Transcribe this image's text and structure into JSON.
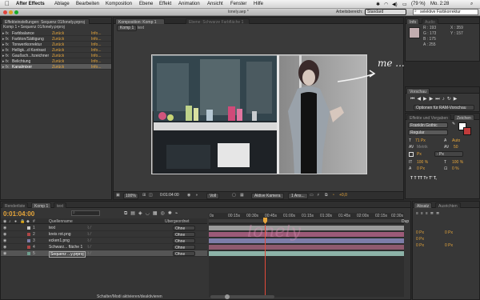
{
  "menubar": {
    "app": "After Effects",
    "items": [
      "Ablage",
      "Bearbeiten",
      "Komposition",
      "Ebene",
      "Effekt",
      "Animation",
      "Ansicht",
      "Fenster",
      "Hilfe"
    ],
    "battery": "(79 %)",
    "clock": "Mo. 2:28"
  },
  "titlebar": {
    "file": "lonely.aep *",
    "workspace_label": "Arbeitsbereich:",
    "workspace_value": "Standard",
    "search_value": "selektive Farbkorrektur"
  },
  "effects_panel": {
    "tab": "Effekteinstellungen: Sequenz 01/lonely.prproj",
    "breadcrumb": "Komp 1 • Sequenz 01/lonely.prproj",
    "reset": "Zurück",
    "info": "Info...",
    "effects": [
      "Farbbalance",
      "Farbton/Sättigung",
      "Tonwertkorrektur",
      "Helligk...d Kontrast",
      "Gaußsch...hzeichner",
      "Belichtung",
      "Kanalmixer"
    ]
  },
  "comp_panel": {
    "tab": "Komposition: Komp 1",
    "tab2": "Ebene: Schwarze Farbfläche 1",
    "subtab": "Komp 1",
    "subtab2": "text",
    "handwriting": "me ..."
  },
  "viewer_bar": {
    "zoom": "100%",
    "timecode": "0:01:04:00",
    "resolution": "Voll",
    "camera": "Aktive Kamera",
    "views": "1 Ans...",
    "offset": "+0,0"
  },
  "info_panel": {
    "tab": "Info",
    "tab2": "Audio",
    "r": "R : 193",
    "g": "G : 173",
    "b": "B : 175",
    "a": "A : 255",
    "x": "X : 359",
    "y": "Y : 157"
  },
  "preview_panel": {
    "tab": "Vorschau",
    "options": "Optionen für RAM-Vorschau"
  },
  "char_panel": {
    "tab": "Effekte und Vorgaben",
    "tab2": "Zeichen",
    "font": "Franklin Gothic",
    "style": "Regular",
    "size": "71 Px",
    "auto": "Auto",
    "metrics": "Metrik",
    "tracking": "50",
    "px": "Px",
    "px_dash": "- Px",
    "pct": "100 %",
    "pct2": "100 %",
    "baseline": "0 Px",
    "pct3": "0 %",
    "tT": "T  T  TT  Tт  T'  T,"
  },
  "para_panel": {
    "tab": "Absatz",
    "tab2": "Ausrichten",
    "v1": "0 Px",
    "v2": "0 Px",
    "v3": "0 Px",
    "v4": "0 Px",
    "v5": "0 Px"
  },
  "timeline": {
    "tab": "Renderliste",
    "tab2": "Komp 1",
    "tab3": "text",
    "timecode": "0:01:04:00",
    "search_placeholder": "",
    "col_source": "Quellenname",
    "col_parent": "Übergeordnet",
    "toggle_modes": "Schalter/Modi aktivieren/deaktivieren",
    "ruler": [
      "0s",
      "00:15s",
      "00:30s",
      "00:45s",
      "01:00s",
      "01:15s",
      "01:30s",
      "01:45s",
      "02:00s",
      "02:15s",
      "02:30s"
    ],
    "layers": [
      {
        "num": "1",
        "name": "text",
        "parent": "Ohne",
        "color": "#c7c7c7"
      },
      {
        "num": "2",
        "name": "kreis rot.png",
        "parent": "Ohne",
        "color": "#b04646"
      },
      {
        "num": "3",
        "name": "ecken1.png",
        "parent": "Ohne",
        "color": "#7d7da8"
      },
      {
        "num": "4",
        "name": "Schwarz... fläche 1",
        "parent": "Ohne",
        "color": "#b04646"
      },
      {
        "num": "5",
        "name": "Sequenz ...y.prproj",
        "parent": "Ohne",
        "color": "#6f9f8f"
      }
    ],
    "dup_label": "Dup",
    "watermark": "lonely"
  }
}
